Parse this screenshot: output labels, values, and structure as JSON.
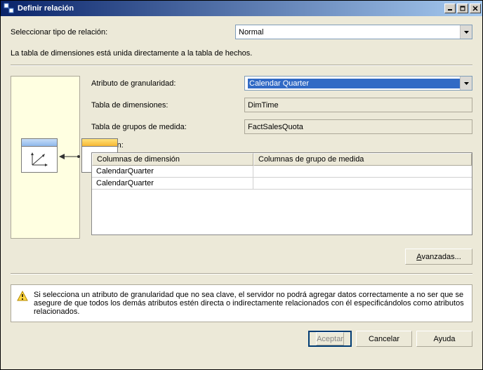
{
  "window": {
    "title": "Definir relación"
  },
  "type_row": {
    "label": "Seleccionar tipo de relación:",
    "value": "Normal"
  },
  "description": "La tabla de dimensiones está unida directamente a la tabla de hechos.",
  "fields": {
    "granularity_label": "Atributo de granularidad:",
    "granularity_value": "Calendar Quarter",
    "dim_table_label": "Tabla de dimensiones:",
    "dim_table_value": "DimTime",
    "mg_table_label": "Tabla de grupos de medida:",
    "mg_table_value": "FactSalesQuota",
    "relation_label": "Relación:"
  },
  "rel_table": {
    "col1": "Columnas de dimensión",
    "col2": "Columnas de grupo de medida",
    "rows": [
      {
        "c1": "CalendarQuarter",
        "c2": ""
      },
      {
        "c1": "CalendarQuarter",
        "c2": ""
      }
    ]
  },
  "buttons": {
    "advanced": "Avanzadas...",
    "accept": "Aceptar",
    "cancel": "Cancelar",
    "help": "Ayuda"
  },
  "warning": "Si selecciona un atributo de granularidad que no sea clave, el servidor no podrá agregar datos correctamente a no ser que se asegure de que todos los demás atributos estén directa o indirectamente relacionados con él especificándolos como atributos relacionados."
}
